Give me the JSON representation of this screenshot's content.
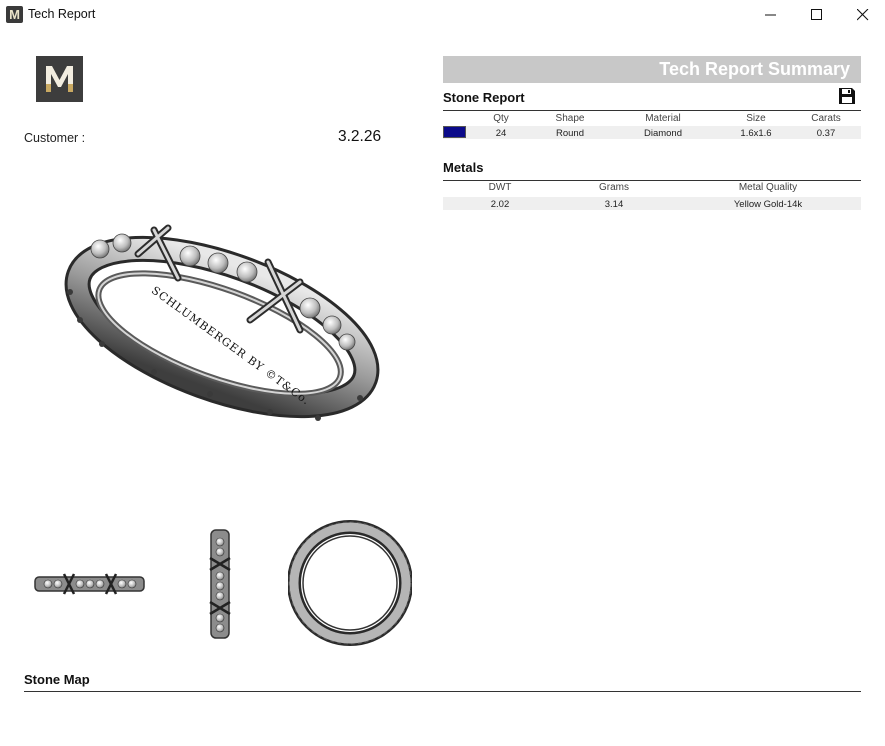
{
  "window": {
    "title": "Tech Report",
    "icon_letter": "M",
    "controls": [
      "minimize-icon",
      "maximize-icon",
      "close-icon"
    ]
  },
  "logo": {
    "letter": "M",
    "bg": "#3d3d3d",
    "accent": "#c9a962"
  },
  "customer": {
    "label": "Customer :",
    "value": "3.2.26"
  },
  "summary": {
    "title": "Tech Report Summary"
  },
  "stone_report": {
    "title": "Stone Report",
    "headers": [
      "Qty",
      "Shape",
      "Material",
      "Size",
      "Carats"
    ],
    "rows": [
      {
        "color": "#0b0a8a",
        "qty": "24",
        "shape": "Round",
        "material": "Diamond",
        "size": "1.6x1.6",
        "carats": "0.37"
      }
    ]
  },
  "metals": {
    "title": "Metals",
    "headers": [
      "DWT",
      "Grams",
      "Metal Quality"
    ],
    "rows": [
      {
        "dwt": "2.02",
        "grams": "3.14",
        "quality": "Yellow Gold-14k"
      }
    ]
  },
  "engraving": {
    "text": "SCHLUMBERGER  BY  ©T&Co."
  },
  "stone_map": {
    "title": "Stone Map"
  }
}
